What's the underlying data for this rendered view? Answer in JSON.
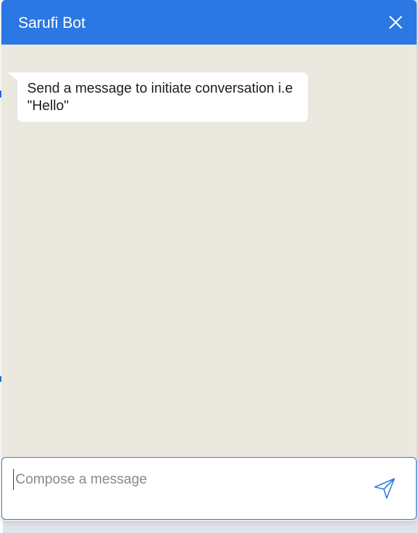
{
  "header": {
    "title": "Sarufi Bot",
    "close_icon": "close-icon",
    "background_color": "#2b78e4"
  },
  "messages": [
    {
      "sender": "bot",
      "text": "Send a message to initiate conversation i.e \"Hello\""
    }
  ],
  "composer": {
    "value": "",
    "placeholder": "Compose a message",
    "send_icon": "send-icon"
  },
  "colors": {
    "accent": "#2b78e4",
    "chat_background": "#ebe8e0",
    "bubble_background": "#ffffff"
  }
}
